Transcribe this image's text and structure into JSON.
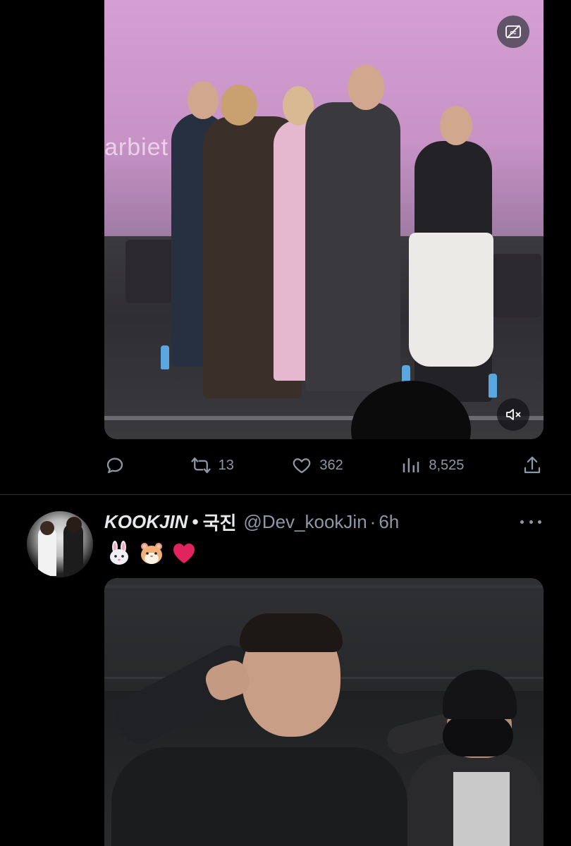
{
  "tweet1": {
    "media": {
      "backdrop_text": "arbiet",
      "cc_icon": "closed-captions-icon",
      "mute_icon": "speaker-muted-icon"
    },
    "actions": {
      "reply": {
        "icon": "reply-icon",
        "count": ""
      },
      "retweet": {
        "icon": "retweet-icon",
        "count": "13"
      },
      "like": {
        "icon": "heart-icon",
        "count": "362"
      },
      "views": {
        "icon": "bar-chart-icon",
        "count": "8,525"
      },
      "share": {
        "icon": "share-icon"
      }
    }
  },
  "tweet2": {
    "display_name": "KOOKJIN",
    "separator": "•",
    "korean_name": "국진",
    "handle": "@Dev_kookJin",
    "time_sep": "·",
    "time": "6h",
    "more_icon": "more-icon",
    "emojis": [
      "rabbit-face",
      "hamster-face",
      "red-heart"
    ]
  },
  "colors": {
    "background": "#000000",
    "text_primary": "#e7e9ea",
    "text_secondary": "#8b98a5",
    "divider": "#2f3336",
    "heart_red": "#e0245e"
  }
}
